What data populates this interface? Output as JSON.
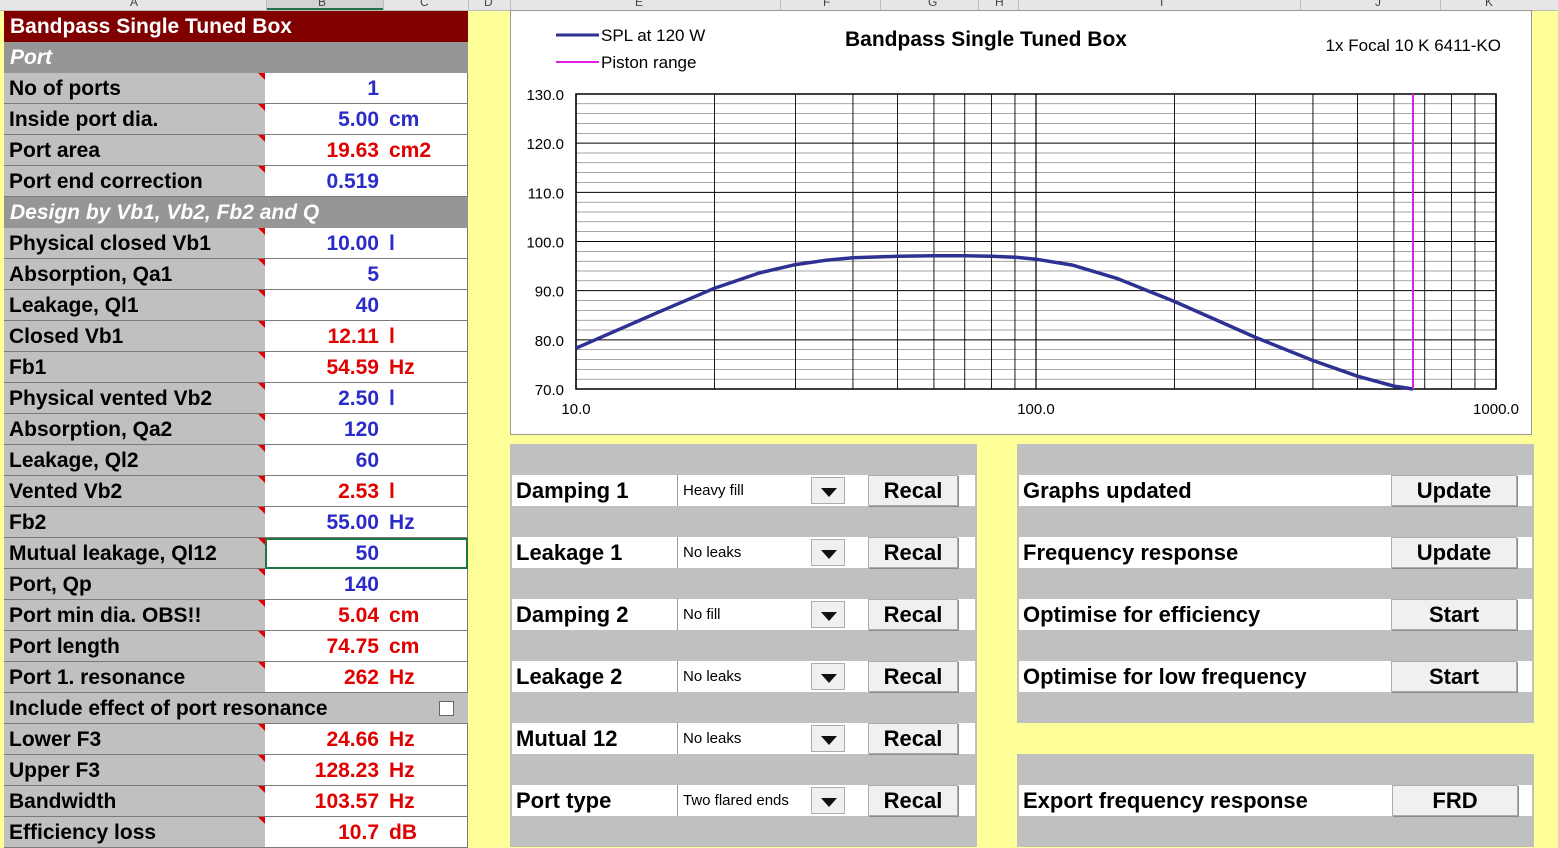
{
  "column_headers": [
    "A",
    "B",
    "C",
    "D",
    "E",
    "F",
    "G",
    "H",
    "I",
    "J",
    "K"
  ],
  "left": {
    "title": "Bandpass Single Tuned Box",
    "section_port": "Port",
    "section_design": "Design by Vb1, Vb2, Fb2 and Q",
    "rows": [
      {
        "label": "No of ports",
        "value": "1",
        "unit": "",
        "color": "blue"
      },
      {
        "label": "Inside port dia.",
        "value": "5.00",
        "unit": "cm",
        "color": "blue"
      },
      {
        "label": "Port area",
        "value": "19.63",
        "unit": "cm2",
        "color": "red"
      },
      {
        "label": "Port end correction",
        "value": "0.519",
        "unit": "",
        "color": "blue"
      },
      {
        "label": "Physical closed Vb1",
        "value": "10.00",
        "unit": "l",
        "color": "blue"
      },
      {
        "label": "Absorption, Qa1",
        "value": "5",
        "unit": "",
        "color": "blue"
      },
      {
        "label": "Leakage, Ql1",
        "value": "40",
        "unit": "",
        "color": "blue"
      },
      {
        "label": "Closed Vb1",
        "value": "12.11",
        "unit": "l",
        "color": "red"
      },
      {
        "label": "Fb1",
        "value": "54.59",
        "unit": "Hz",
        "color": "red"
      },
      {
        "label": "Physical vented Vb2",
        "value": "2.50",
        "unit": "l",
        "color": "blue"
      },
      {
        "label": "Absorption, Qa2",
        "value": "120",
        "unit": "",
        "color": "blue"
      },
      {
        "label": "Leakage, Ql2",
        "value": "60",
        "unit": "",
        "color": "blue"
      },
      {
        "label": "Vented Vb2",
        "value": "2.53",
        "unit": "l",
        "color": "red"
      },
      {
        "label": "Fb2",
        "value": "55.00",
        "unit": "Hz",
        "color": "blue"
      },
      {
        "label": "Mutual leakage, Ql12",
        "value": "50",
        "unit": "",
        "color": "blue"
      },
      {
        "label": "Port, Qp",
        "value": "140",
        "unit": "",
        "color": "blue"
      },
      {
        "label": "Port min dia. OBS!!",
        "value": "5.04",
        "unit": "cm",
        "color": "red"
      },
      {
        "label": "Port length",
        "value": "74.75",
        "unit": "cm",
        "color": "red"
      },
      {
        "label": "Port 1. resonance",
        "value": "262",
        "unit": "Hz",
        "color": "red"
      },
      {
        "label": "Include effect of port resonance",
        "value": "",
        "unit": "",
        "color": "blue"
      },
      {
        "label": "Lower F3",
        "value": "24.66",
        "unit": "Hz",
        "color": "red"
      },
      {
        "label": "Upper F3",
        "value": "128.23",
        "unit": "Hz",
        "color": "red"
      },
      {
        "label": "Bandwidth",
        "value": "103.57",
        "unit": "Hz",
        "color": "red"
      },
      {
        "label": "Efficiency loss",
        "value": "10.7",
        "unit": "dB",
        "color": "red"
      }
    ]
  },
  "chart_data": {
    "type": "line",
    "title": "Bandpass Single Tuned Box",
    "subtitle": "1x Focal 10 K 6411-KO",
    "xscale": "log",
    "xlim": [
      10,
      1000
    ],
    "ylim": [
      70,
      130
    ],
    "xticks": [
      "10.0",
      "100.0",
      "1000.0"
    ],
    "yticks": [
      "70.0",
      "80.0",
      "90.0",
      "100.0",
      "110.0",
      "120.0",
      "130.0"
    ],
    "grid": true,
    "legend": "top-left",
    "series": [
      {
        "name": "SPL at 120 W",
        "color": "#2e3192",
        "x": [
          10,
          15,
          20,
          25,
          30,
          35,
          40,
          50,
          60,
          70,
          80,
          90,
          100,
          120,
          150,
          200,
          300,
          400,
          500,
          600,
          660
        ],
        "y": [
          78.3,
          85.5,
          90.5,
          93.6,
          95.3,
          96.2,
          96.7,
          97.0,
          97.1,
          97.1,
          97.0,
          96.8,
          96.4,
          95.2,
          92.5,
          87.8,
          80.5,
          75.8,
          72.6,
          70.6,
          70.0
        ]
      },
      {
        "name": "Piston range",
        "color": "#e020e0",
        "x": [
          660,
          660
        ],
        "y": [
          70,
          130
        ]
      }
    ]
  },
  "controls_left": [
    {
      "label": "Damping 1",
      "option": "Heavy fill",
      "button": "Recal"
    },
    {
      "label": "Leakage 1",
      "option": "No leaks",
      "button": "Recal"
    },
    {
      "label": "Damping 2",
      "option": "No fill",
      "button": "Recal"
    },
    {
      "label": "Leakage 2",
      "option": "No leaks",
      "button": "Recal"
    },
    {
      "label": "Mutual 12",
      "option": "No leaks",
      "button": "Recal"
    },
    {
      "label": "Port type",
      "option": "Two flared ends",
      "button": "Recal"
    }
  ],
  "controls_right": [
    {
      "label": "Graphs updated",
      "button": "Update"
    },
    {
      "label": "Frequency response",
      "button": "Update"
    },
    {
      "label": "Optimise for efficiency",
      "button": "Start"
    },
    {
      "label": "Optimise for low frequency",
      "button": "Start"
    }
  ],
  "export": {
    "label": "Export frequency response",
    "button": "FRD"
  }
}
